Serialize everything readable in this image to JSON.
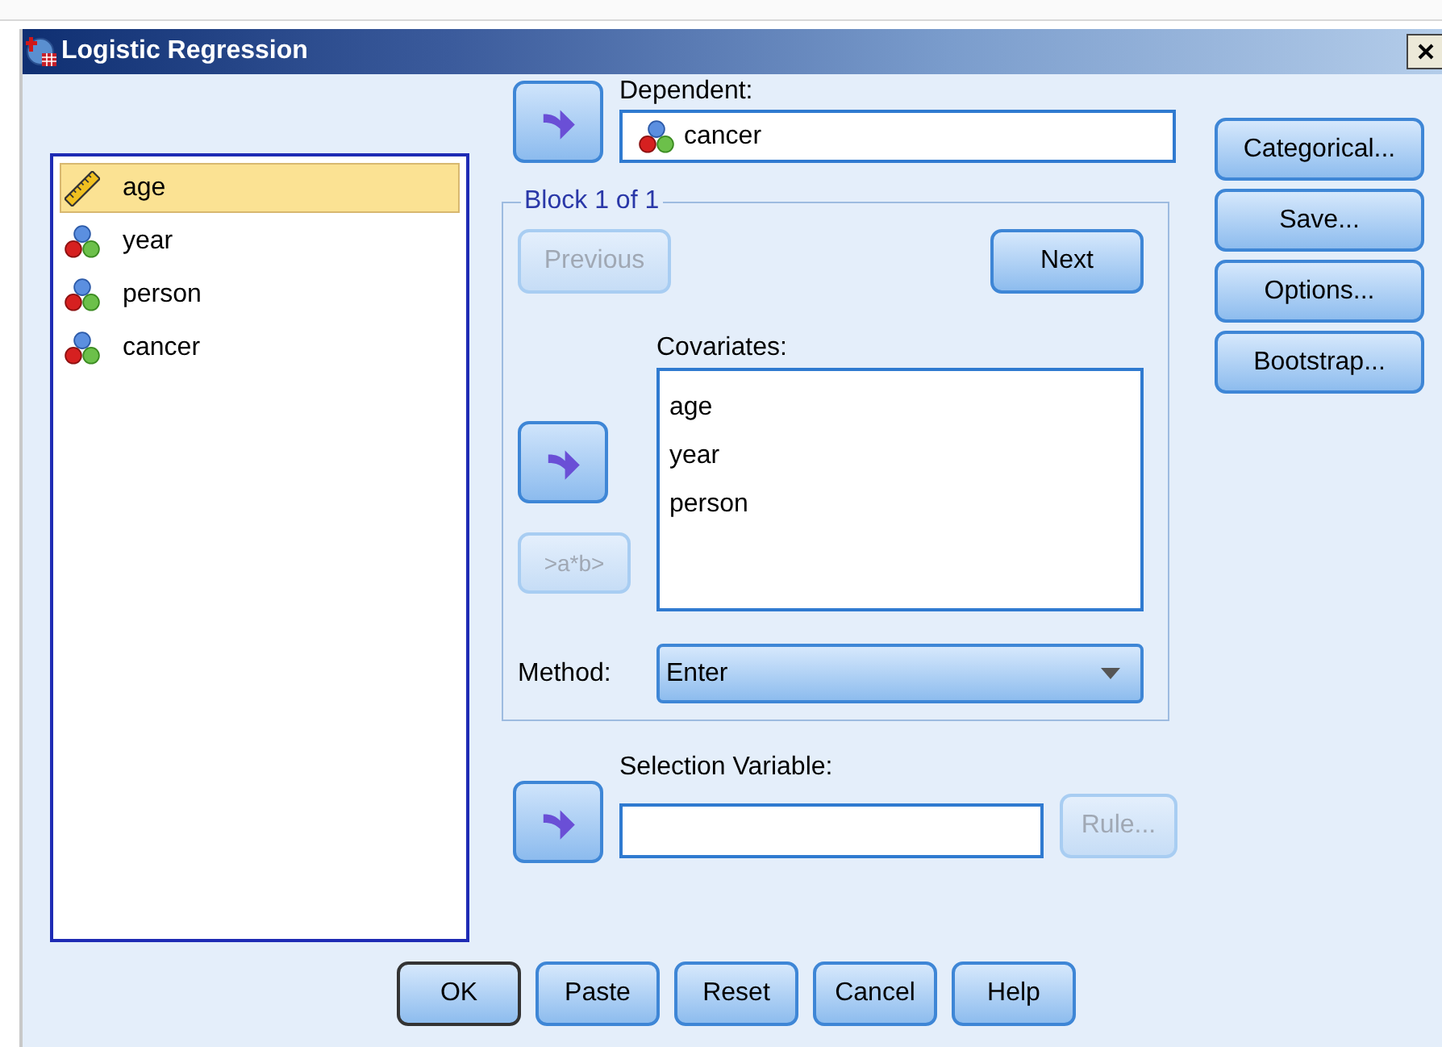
{
  "window": {
    "title": "Logistic Regression"
  },
  "variables": [
    {
      "name": "age",
      "kind": "scale",
      "selected": true
    },
    {
      "name": "year",
      "kind": "nominal",
      "selected": false
    },
    {
      "name": "person",
      "kind": "nominal",
      "selected": false
    },
    {
      "name": "cancer",
      "kind": "nominal",
      "selected": false
    }
  ],
  "dependent": {
    "label": "Dependent:",
    "value": "cancer",
    "kind": "nominal"
  },
  "block": {
    "label": "Block 1 of 1",
    "previous": {
      "label": "Previous",
      "disabled": true
    },
    "next": {
      "label": "Next",
      "disabled": false
    },
    "interaction": {
      "label": ">a*b>",
      "disabled": true
    },
    "covariates": {
      "label": "Covariates:",
      "items": [
        "age",
        "year",
        "person"
      ]
    },
    "method": {
      "label": "Method:",
      "value": "Enter"
    }
  },
  "selection": {
    "label": "Selection Variable:",
    "rule": {
      "label": "Rule...",
      "disabled": true
    }
  },
  "side_buttons": [
    {
      "label": "Categorical..."
    },
    {
      "label": "Save..."
    },
    {
      "label": "Options..."
    },
    {
      "label": "Bootstrap..."
    }
  ],
  "buttons": [
    {
      "label": "OK",
      "default": true
    },
    {
      "label": "Paste",
      "default": false
    },
    {
      "label": "Reset",
      "default": false
    },
    {
      "label": "Cancel",
      "default": false
    },
    {
      "label": "Help",
      "default": false
    }
  ]
}
